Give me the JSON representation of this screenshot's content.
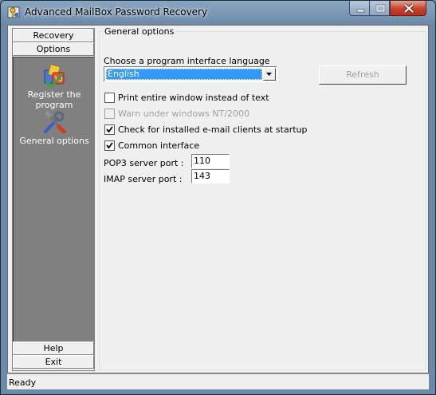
{
  "window": {
    "title": "Advanced MailBox Password Recovery"
  },
  "sidebar": {
    "top_buttons": [
      "Recovery",
      "Options"
    ],
    "items": [
      {
        "label": "Register the program",
        "icon": "register-icon"
      },
      {
        "label": "General options",
        "icon": "tools-icon"
      }
    ],
    "bottom_buttons": [
      "Help",
      "Exit"
    ]
  },
  "group": {
    "title": "General options"
  },
  "language": {
    "label": "Choose a program interface language",
    "selected": "English"
  },
  "refresh_label": "Refresh",
  "options": [
    {
      "label": "Print entire window instead of text",
      "checked": false,
      "enabled": true
    },
    {
      "label": "Warn under windows NT/2000",
      "checked": false,
      "enabled": false
    },
    {
      "label": "Check for installed e-mail clients at startup",
      "checked": true,
      "enabled": true
    },
    {
      "label": "Common interface",
      "checked": true,
      "enabled": true
    }
  ],
  "ports": {
    "pop3": {
      "label": "POP3 server port :",
      "value": "110"
    },
    "imap": {
      "label": "IMAP server port :",
      "value": "143"
    }
  },
  "status": {
    "text": "Ready"
  }
}
